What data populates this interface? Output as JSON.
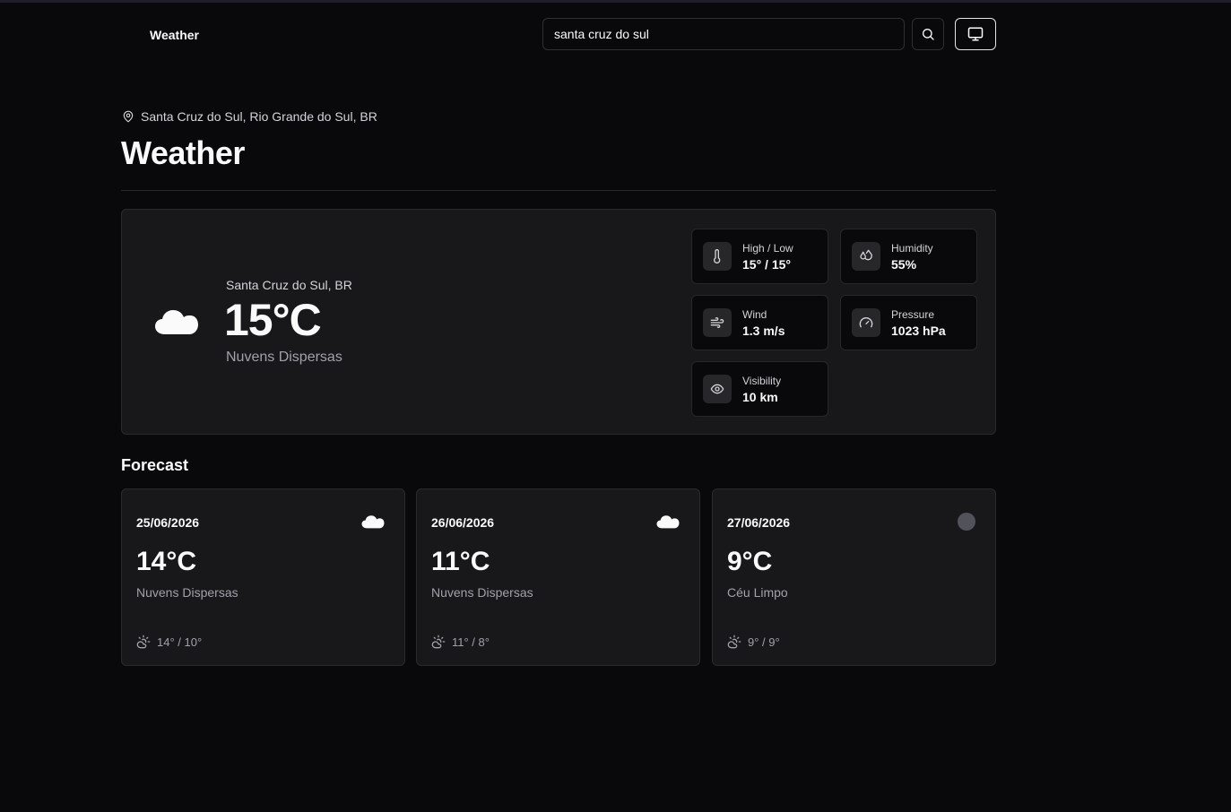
{
  "header": {
    "brand": "Weather",
    "search": {
      "value": "santa cruz do sul",
      "placeholder": ""
    },
    "search_button_icon": "search-icon",
    "theme_button_icon": "monitor-icon"
  },
  "page": {
    "location": "Santa Cruz do Sul, Rio Grande do Sul, BR",
    "title": "Weather"
  },
  "current": {
    "icon": "cloud-icon",
    "city": "Santa Cruz do Sul, BR",
    "temperature": "15°C",
    "description": "Nuvens Dispersas",
    "stats": [
      {
        "icon": "thermometer-icon",
        "label": "High / Low",
        "value": "15° / 15°"
      },
      {
        "icon": "droplets-icon",
        "label": "Humidity",
        "value": "55%"
      },
      {
        "icon": "wind-icon",
        "label": "Wind",
        "value": "1.3 m/s"
      },
      {
        "icon": "gauge-icon",
        "label": "Pressure",
        "value": "1023 hPa"
      },
      {
        "icon": "eye-icon",
        "label": "Visibility",
        "value": "10 km"
      }
    ]
  },
  "forecast": {
    "title": "Forecast",
    "days": [
      {
        "date": "25/06/2026",
        "icon": "cloud-icon",
        "temperature": "14°C",
        "description": "Nuvens Dispersas",
        "range": "14° / 10°"
      },
      {
        "date": "26/06/2026",
        "icon": "cloud-icon",
        "temperature": "11°C",
        "description": "Nuvens Dispersas",
        "range": "11° / 8°"
      },
      {
        "date": "27/06/2026",
        "icon": "clear-sky-icon",
        "temperature": "9°C",
        "description": "Céu Limpo",
        "range": "9° / 9°"
      }
    ]
  },
  "colors": {
    "background": "#09090b",
    "card": "#18181b",
    "border": "#27272a",
    "muted_text": "#a1a1aa"
  }
}
